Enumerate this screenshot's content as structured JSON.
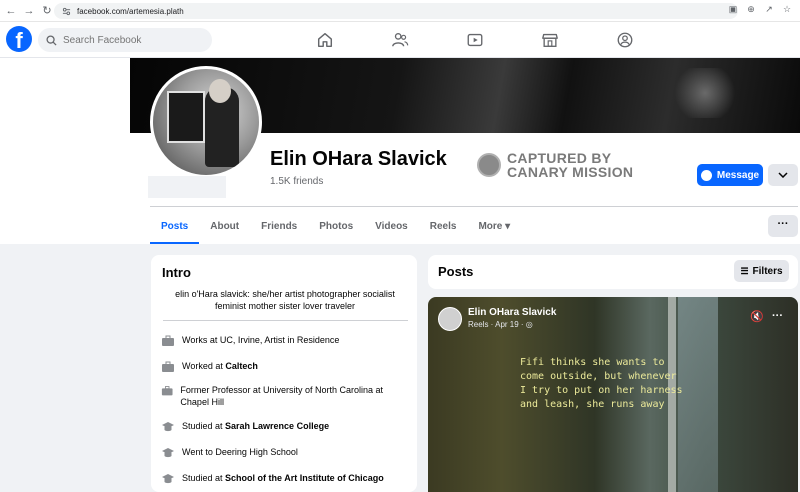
{
  "browser": {
    "url": "facebook.com/artemesia.plath"
  },
  "topbar": {
    "search_placeholder": "Search Facebook",
    "logo": "f"
  },
  "profile": {
    "name": "Elin OHara Slavick",
    "friends": "1.5K friends",
    "captured_line1": "CAPTURED BY",
    "captured_line2": "CANARY MISSION",
    "message_label": "Message",
    "more_label": "···"
  },
  "tabs": [
    "Posts",
    "About",
    "Friends",
    "Photos",
    "Videos",
    "Reels",
    "More ▾"
  ],
  "intro": {
    "title": "Intro",
    "bio": "elin o'Hara slavick: she/her artist photographer socialist feminist mother sister lover traveler",
    "items": [
      {
        "pre": "Works at UC, Irvine, Artist in Residence",
        "bold": ""
      },
      {
        "pre": "Worked at ",
        "bold": "Caltech"
      },
      {
        "pre": "Former Professor at University of North Carolina at Chapel Hill",
        "bold": ""
      },
      {
        "pre": "Studied at ",
        "bold": "Sarah Lawrence College"
      },
      {
        "pre": "Went to Deering High School",
        "bold": ""
      },
      {
        "pre": "Studied at ",
        "bold": "School of the Art Institute of Chicago"
      }
    ]
  },
  "posts": {
    "title": "Posts",
    "filters_label": "Filters"
  },
  "reel": {
    "author": "Elin OHara Slavick",
    "meta": "Reels · Apr 19 · ◎",
    "caption": "Fifi thinks she wants to\ncome outside, but whenever\nI try to put on her harness\nand leash, she runs away"
  },
  "colors": {
    "brand": "#0866ff",
    "page_bg": "#f0f2f5",
    "caption": "#ecea9a"
  }
}
